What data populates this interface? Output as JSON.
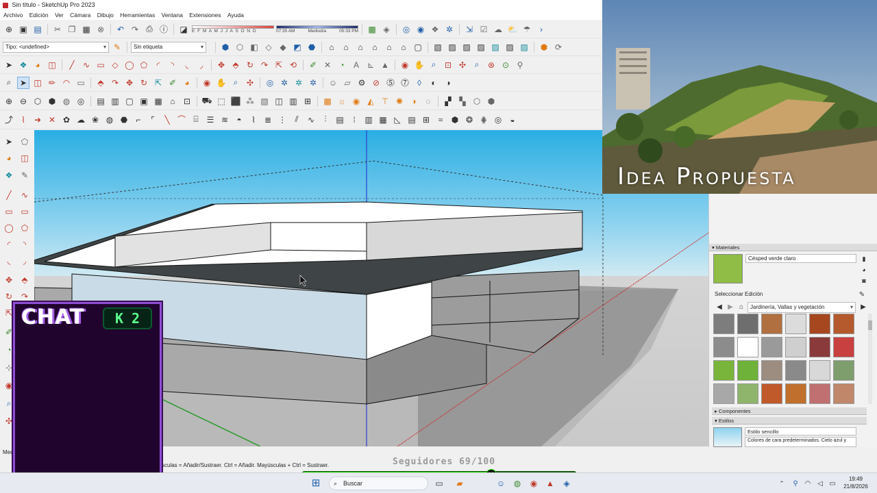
{
  "window": {
    "title": "Sin título - SketchUp Pro 2023"
  },
  "menu": [
    "Archivo",
    "Edición",
    "Ver",
    "Cámara",
    "Dibujo",
    "Herramientas",
    "Ventana",
    "Extensiones",
    "Ayuda"
  ],
  "shadow": {
    "months": "E F M A M J J A S O N D",
    "time_start": "07:35 AM",
    "time_mid": "Mediodía",
    "time_end": "05:33 PM"
  },
  "type_dropdown": "Tipo: <undefined>",
  "tag_dropdown": "Sin etiqueta",
  "overlay": {
    "title": "Idea Propuesta",
    "chat_label": "CHAT",
    "chat_badge": "K 2",
    "followers": "Seguidores 69/100",
    "followers_progress": 0.69,
    "progress_knob": "K"
  },
  "status": {
    "hint": "sculas = Añadir/Sustraer. Ctrl = Añadir. Mayúsculas + Ctrl = Sustraer.",
    "measure_label": "Medi"
  },
  "materials": {
    "panel_title": "Materiales",
    "current_name": "Césped verde claro",
    "tab_select": "Seleccionar",
    "tab_edit": "Edición",
    "library": "Jardinería, Vallas y vegetación",
    "swatch_colors": [
      "#7d7d7d",
      "#6e6e6e",
      "#b0703f",
      "#dcdcdc",
      "#a64720",
      "#b45a2c",
      "#8c8c8c",
      "#ffffff",
      "#9a9a9a",
      "#cfcfcf",
      "#8a3a3a",
      "#c94040",
      "#79b43b",
      "#6fb23a",
      "#9c8d80",
      "#8a8a8a",
      "#d8d8d8",
      "#7f9e6e",
      "#a8a8a8",
      "#8fb46b",
      "#c05a2a",
      "#c0702c",
      "#c07070",
      "#c0876a"
    ]
  },
  "components": {
    "title": "Componentes"
  },
  "styles": {
    "title": "Estilos",
    "style_name": "Estilo sencillo",
    "style_desc": "Colores de cara predeterminados. Cielo azul y"
  },
  "taskbar": {
    "search_placeholder": "Buscar",
    "time": "19:49",
    "date": "21/8/2026"
  },
  "colors": {
    "sky_top": "#29aee3",
    "ground": "#c9c9c9",
    "chat_bg": "#21042d",
    "chat_border": "#8e4fd4",
    "progress_green": "#22e000"
  }
}
